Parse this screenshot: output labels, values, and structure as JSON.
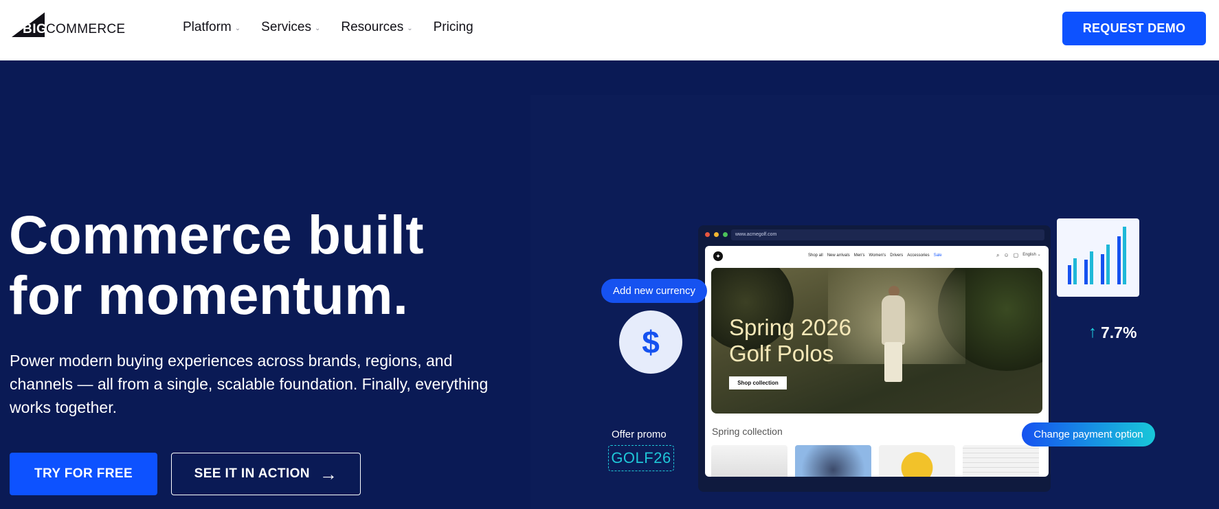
{
  "header": {
    "logo_big": "BIG",
    "logo_commerce": "COMMERCE",
    "nav": [
      {
        "label": "Platform",
        "has_menu": true
      },
      {
        "label": "Services",
        "has_menu": true
      },
      {
        "label": "Resources",
        "has_menu": true
      },
      {
        "label": "Pricing",
        "has_menu": false
      }
    ],
    "caret_glyph": "⌄",
    "cta": "REQUEST DEMO"
  },
  "hero": {
    "headline_line1": "Commerce built",
    "headline_line2": "for momentum.",
    "subtext": "Power modern buying experiences across brands, regions, and channels — all from a single, scalable foundation. Finally, everything works together.",
    "primary_button": "TRY FOR FREE",
    "secondary_button": "SEE IT IN ACTION",
    "secondary_arrow": "→"
  },
  "mockup": {
    "url": "www.acmegolf.com",
    "store_nav": [
      "Shop all",
      "New arrivals",
      "Men's",
      "Women's",
      "Drivers",
      "Accessories",
      "Sale"
    ],
    "language": "English ⌄",
    "banner_line1": "Spring 2026",
    "banner_line2": "Golf Polos",
    "shop_button": "Shop collection",
    "section_label": "Spring collection"
  },
  "widgets": {
    "currency_pill": "Add new currency",
    "currency_symbol": "$",
    "payment_pill": "Change payment option",
    "stat_arrow": "↑",
    "stat_value": "7.7%",
    "promo_label": "Offer promo",
    "promo_code": "GOLF26"
  },
  "colors": {
    "accent": "#0d52ff",
    "hero_bg": "#0a1a55",
    "teal": "#1fd0e0"
  }
}
